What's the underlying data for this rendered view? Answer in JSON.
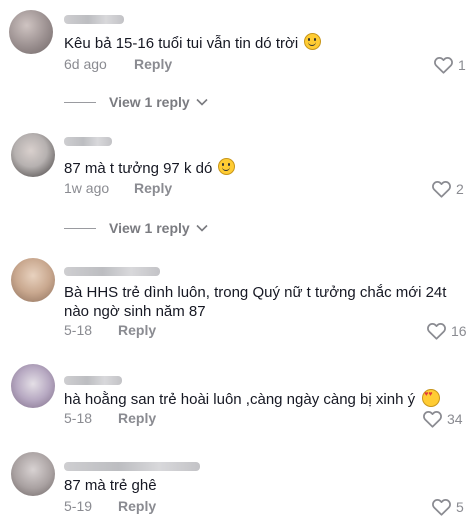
{
  "comments": [
    {
      "text": "Kêu bả 15-16 tuổi tui vẫn tin dó trời",
      "emoji": "smile-emoji",
      "time": "6d ago",
      "reply_label": "Reply",
      "likes": "1",
      "view_replies": "View 1 reply"
    },
    {
      "text": "87 mà t tưởng 97 k dó",
      "emoji": "smile-emoji",
      "time": "1w ago",
      "reply_label": "Reply",
      "likes": "2",
      "view_replies": "View 1 reply"
    },
    {
      "text": "Bà HHS trẻ dình luôn, trong Quý nữ t tưởng chắc mới 24t nào ngờ sinh năm 87",
      "time": "5-18",
      "reply_label": "Reply",
      "likes": "16"
    },
    {
      "text": "hà hoằng san trẻ hoài luôn ,càng ngày càng bị xinh ý",
      "emoji": "smiling-face-with-hearts-emoji",
      "time": "5-18",
      "reply_label": "Reply",
      "likes": "34"
    },
    {
      "text": "87 mà trẻ ghê",
      "time": "5-19",
      "reply_label": "Reply",
      "likes": "5"
    }
  ],
  "colors": {
    "text": "#161823",
    "muted": "#8a8b91",
    "background": "#ffffff"
  }
}
